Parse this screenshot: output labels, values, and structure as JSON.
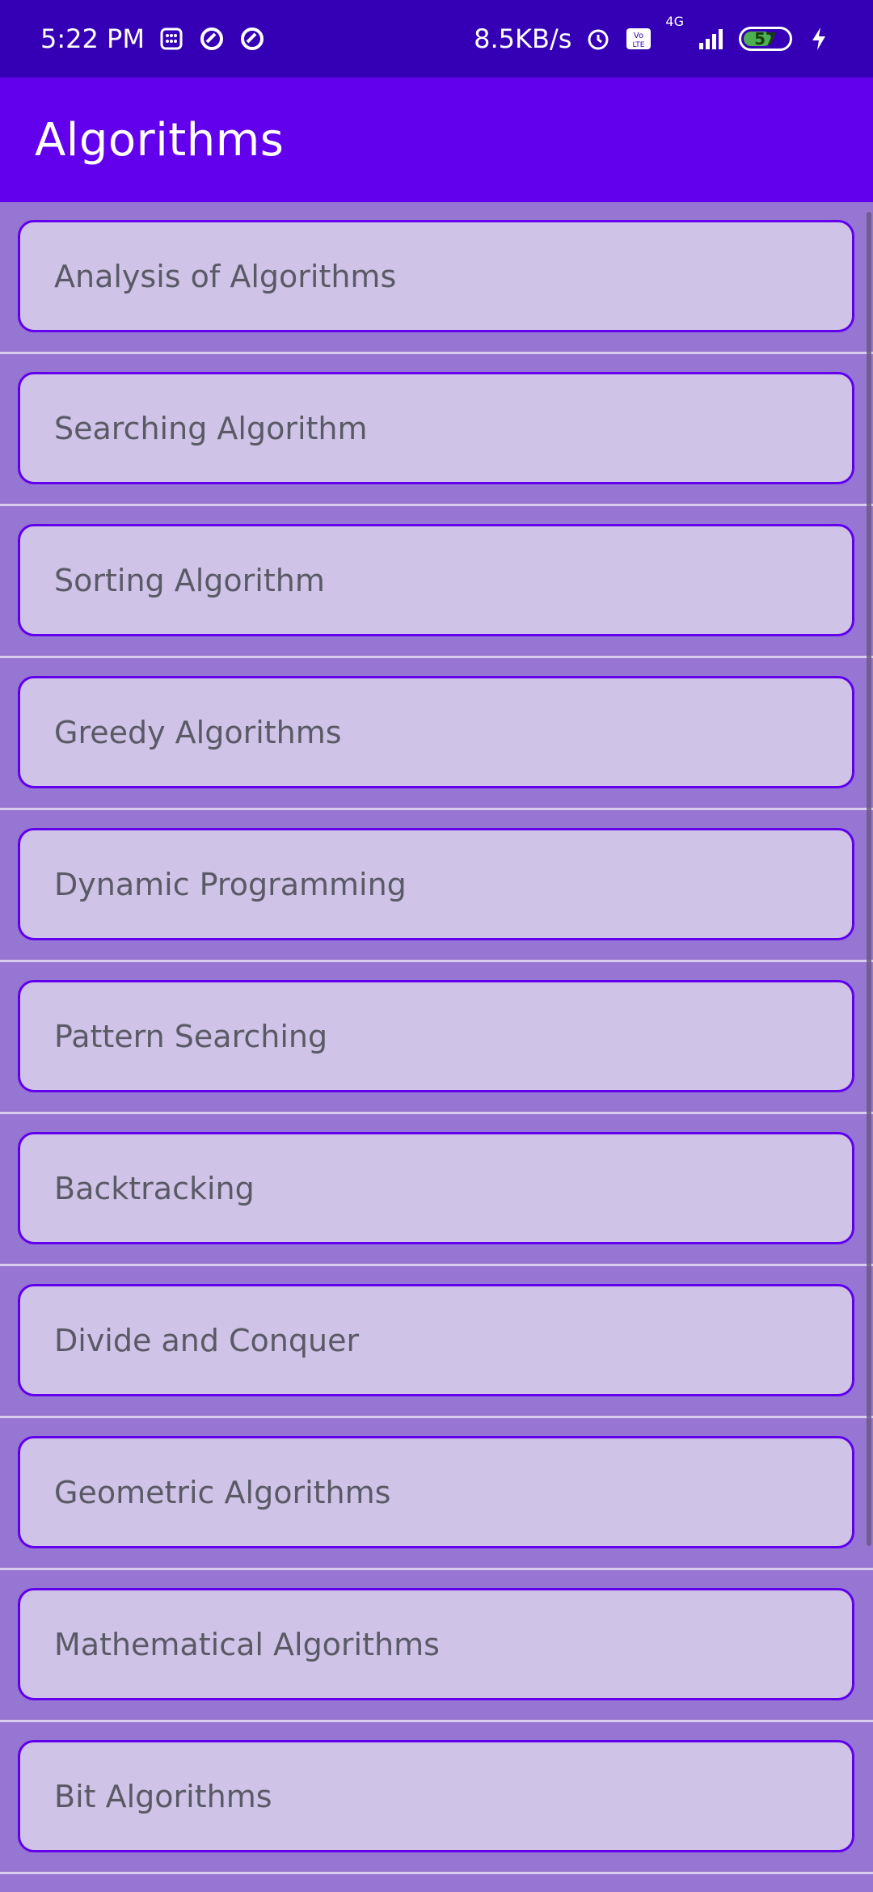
{
  "status_bar": {
    "time": "5:22 PM",
    "speed": "8.5KB/s",
    "network": "4G",
    "battery": "57",
    "icons_left": [
      "calculator-icon",
      "sync-icon",
      "sync-icon"
    ],
    "icons_right": [
      "alarm-icon",
      "volte-icon",
      "signal-icon",
      "battery-icon",
      "charging-icon"
    ]
  },
  "app_bar": {
    "title": "Algorithms"
  },
  "list": {
    "items": [
      {
        "label": "Analysis of Algorithms"
      },
      {
        "label": "Searching Algorithm"
      },
      {
        "label": "Sorting Algorithm"
      },
      {
        "label": "Greedy Algorithms"
      },
      {
        "label": "Dynamic Programming"
      },
      {
        "label": "Pattern Searching"
      },
      {
        "label": "Backtracking"
      },
      {
        "label": "Divide and Conquer"
      },
      {
        "label": "Geometric Algorithms"
      },
      {
        "label": "Mathematical Algorithms"
      },
      {
        "label": "Bit Algorithms"
      }
    ]
  },
  "colors": {
    "status_bar": "#3500B5",
    "app_bar": "#6200EE",
    "background": "#9676D2",
    "card": "#CFC3E8",
    "card_border": "#6200EE"
  }
}
